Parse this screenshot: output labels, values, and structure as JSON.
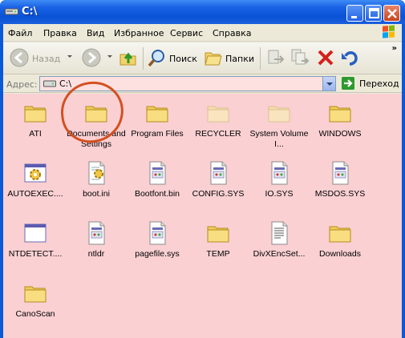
{
  "window": {
    "title": "C:\\"
  },
  "menu": [
    "Файл",
    "Правка",
    "Вид",
    "Избранное",
    "Сервис",
    "Справка"
  ],
  "toolbar": {
    "back_label": "Назад",
    "search_label": "Поиск",
    "folders_label": "Папки"
  },
  "address": {
    "label": "Адрес:",
    "value": "C:\\",
    "go_label": "Переход"
  },
  "files": [
    {
      "name": "ATI",
      "type": "folder",
      "icon": "folder-icon"
    },
    {
      "name": "Documents and Settings",
      "type": "folder",
      "icon": "folder-icon"
    },
    {
      "name": "Program Files",
      "type": "folder",
      "icon": "folder-icon"
    },
    {
      "name": "RECYCLER",
      "type": "folder-hidden",
      "icon": "folder-icon"
    },
    {
      "name": "System Volume I...",
      "type": "folder-hidden",
      "icon": "folder-icon"
    },
    {
      "name": "WINDOWS",
      "type": "folder",
      "icon": "folder-icon"
    },
    {
      "name": "AUTOEXEC....",
      "type": "system",
      "icon": "gear-window-icon"
    },
    {
      "name": "boot.ini",
      "type": "settings",
      "icon": "settings-file-icon"
    },
    {
      "name": "Bootfont.bin",
      "type": "system-file",
      "icon": "system-file-icon"
    },
    {
      "name": "CONFIG.SYS",
      "type": "system-file",
      "icon": "system-file-icon"
    },
    {
      "name": "IO.SYS",
      "type": "system-file",
      "icon": "system-file-icon"
    },
    {
      "name": "MSDOS.SYS",
      "type": "system-file",
      "icon": "system-file-icon"
    },
    {
      "name": "NTDETECT....",
      "type": "app",
      "icon": "app-window-icon"
    },
    {
      "name": "ntldr",
      "type": "system-file",
      "icon": "system-file-icon"
    },
    {
      "name": "pagefile.sys",
      "type": "system-file",
      "icon": "system-file-icon"
    },
    {
      "name": "TEMP",
      "type": "folder",
      "icon": "folder-icon"
    },
    {
      "name": "DivXEncSet...",
      "type": "text",
      "icon": "text-file-icon"
    },
    {
      "name": "Downloads",
      "type": "folder",
      "icon": "folder-icon"
    },
    {
      "name": "CanoScan",
      "type": "folder",
      "icon": "folder-icon"
    }
  ],
  "colors": {
    "file_area_bg": "#fad0d3",
    "titlebar": "#0a52d6",
    "highlight_circle": "#d45020"
  }
}
